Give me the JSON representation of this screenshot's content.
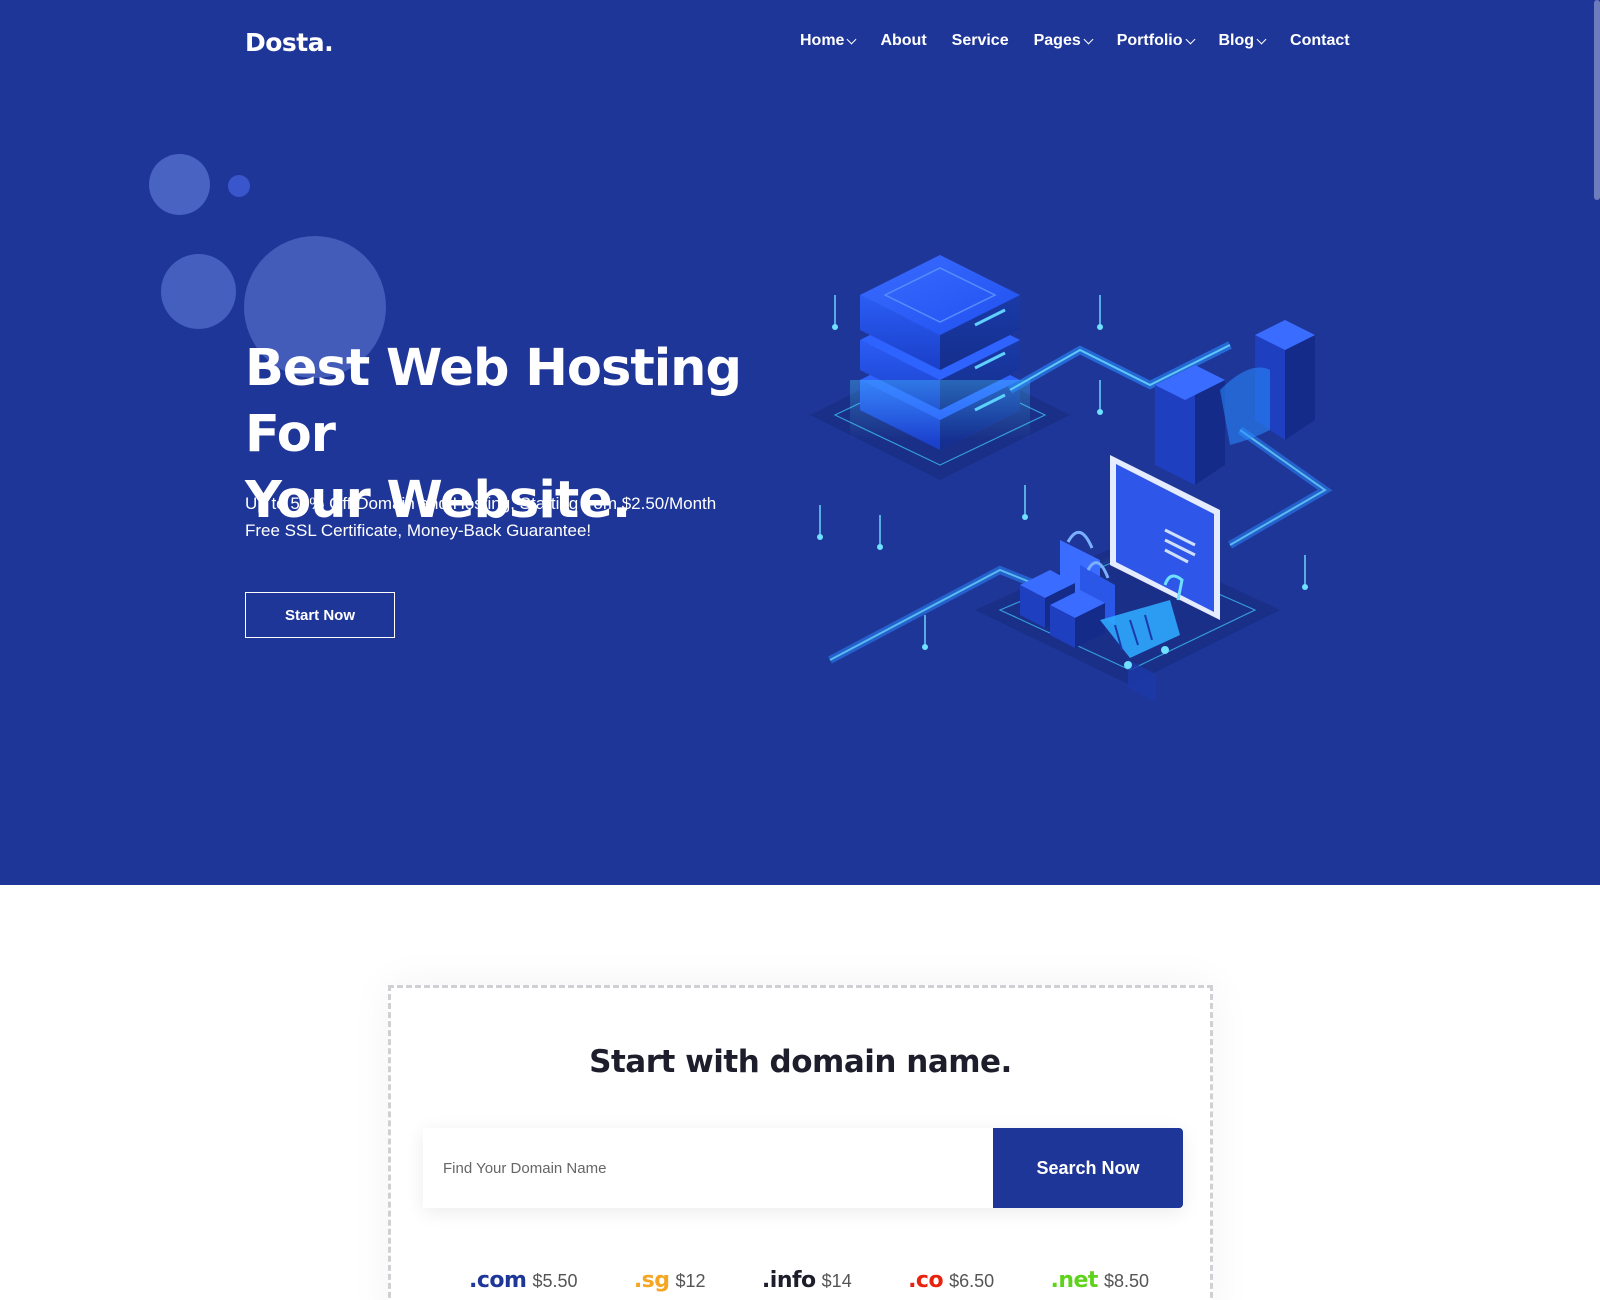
{
  "brand": {
    "logo": "Dosta."
  },
  "nav": [
    {
      "label": "Home",
      "dropdown": true
    },
    {
      "label": "About",
      "dropdown": false
    },
    {
      "label": "Service",
      "dropdown": false
    },
    {
      "label": "Pages",
      "dropdown": true
    },
    {
      "label": "Portfolio",
      "dropdown": true
    },
    {
      "label": "Blog",
      "dropdown": true
    },
    {
      "label": "Contact",
      "dropdown": false
    }
  ],
  "hero": {
    "title_line1": "Best Web Hosting For",
    "title_line2": "Your Website.",
    "subtitle_line1": "Up to 50% Off Domain and Hosting, Starting from $2.50/Month",
    "subtitle_line2": "Free SSL Certificate, Money-Back Guarantee!",
    "cta_label": "Start Now",
    "illustration": "hosting-servers-ecommerce-isometric"
  },
  "domain": {
    "title": "Start with domain name.",
    "search_placeholder": "Find Your Domain Name",
    "search_button": "Search Now",
    "tlds": [
      {
        "ext": ".com",
        "price": "$5.50",
        "color": "#1f3699"
      },
      {
        "ext": ".sg",
        "price": "$12",
        "color": "#f5a623"
      },
      {
        "ext": ".info",
        "price": "$14",
        "color": "#1d1d2b"
      },
      {
        "ext": ".co",
        "price": "$6.50",
        "color": "#e8220c"
      },
      {
        "ext": ".net",
        "price": "$8.50",
        "color": "#5fd31b"
      }
    ]
  },
  "colors": {
    "primary": "#1f3699",
    "white": "#ffffff",
    "text_dark": "#1d1d2b"
  }
}
